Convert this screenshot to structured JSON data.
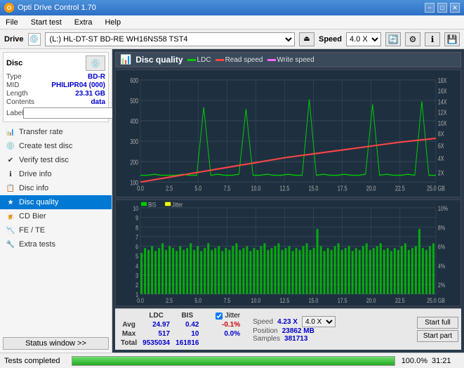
{
  "app": {
    "title": "Opti Drive Control 1.70",
    "icon": "O"
  },
  "titlebar": {
    "minimize": "−",
    "maximize": "□",
    "close": "✕"
  },
  "menu": {
    "items": [
      "File",
      "Start test",
      "Extra",
      "Help"
    ]
  },
  "drivebar": {
    "drive_label": "Drive",
    "drive_value": "(L:)  HL-DT-ST BD-RE  WH16NS58 TST4",
    "speed_label": "Speed",
    "speed_value": "4.0 X"
  },
  "disc": {
    "title": "Disc",
    "type_label": "Type",
    "type_value": "BD-R",
    "mid_label": "MID",
    "mid_value": "PHILIPR04 (000)",
    "length_label": "Length",
    "length_value": "23.31 GB",
    "contents_label": "Contents",
    "contents_value": "data",
    "label_label": "Label",
    "label_placeholder": ""
  },
  "nav": {
    "items": [
      {
        "id": "transfer-rate",
        "label": "Transfer rate",
        "icon": "📊"
      },
      {
        "id": "create-test-disc",
        "label": "Create test disc",
        "icon": "💿"
      },
      {
        "id": "verify-test-disc",
        "label": "Verify test disc",
        "icon": "✔"
      },
      {
        "id": "drive-info",
        "label": "Drive info",
        "icon": "ℹ"
      },
      {
        "id": "disc-info",
        "label": "Disc info",
        "icon": "📋"
      },
      {
        "id": "disc-quality",
        "label": "Disc quality",
        "icon": "★",
        "active": true
      },
      {
        "id": "cd-bier",
        "label": "CD Bier",
        "icon": "🍺"
      },
      {
        "id": "fe-te",
        "label": "FE / TE",
        "icon": "📉"
      },
      {
        "id": "extra-tests",
        "label": "Extra tests",
        "icon": "🔧"
      }
    ],
    "status_window": "Status window >>"
  },
  "chart": {
    "title": "Disc quality",
    "legend": [
      {
        "label": "LDC",
        "color": "#00aa00"
      },
      {
        "label": "Read speed",
        "color": "#ff0000"
      },
      {
        "label": "Write speed",
        "color": "#ff66ff"
      }
    ],
    "chart1": {
      "y_max": 600,
      "y_labels": [
        "600",
        "500",
        "400",
        "300",
        "200",
        "100"
      ],
      "y_right": [
        "18X",
        "16X",
        "14X",
        "12X",
        "10X",
        "8X",
        "6X",
        "4X",
        "2X"
      ],
      "x_labels": [
        "0.0",
        "2.5",
        "5.0",
        "7.5",
        "10.0",
        "12.5",
        "15.0",
        "17.5",
        "20.0",
        "22.5",
        "25.0 GB"
      ]
    },
    "chart2": {
      "title": "BIS",
      "title2": "Jitter",
      "y_max": 10,
      "y_labels": [
        "10",
        "9",
        "8",
        "7",
        "6",
        "5",
        "4",
        "3",
        "2",
        "1"
      ],
      "y_right": [
        "10%",
        "8%",
        "6%",
        "4%",
        "2%"
      ],
      "x_labels": [
        "0.0",
        "2.5",
        "5.0",
        "7.5",
        "10.0",
        "12.5",
        "15.0",
        "17.5",
        "20.0",
        "22.5",
        "25.0 GB"
      ]
    }
  },
  "stats": {
    "headers": [
      "LDC",
      "BIS",
      "",
      "Jitter",
      "Speed"
    ],
    "avg_label": "Avg",
    "avg_ldc": "24.97",
    "avg_bis": "0.42",
    "avg_jitter": "-0.1%",
    "max_label": "Max",
    "max_ldc": "517",
    "max_bis": "10",
    "max_jitter": "0.0%",
    "total_label": "Total",
    "total_ldc": "9535034",
    "total_bis": "161816",
    "speed_label": "Speed",
    "speed_value": "4.23 X",
    "speed_select": "4.0 X",
    "position_label": "Position",
    "position_value": "23862 MB",
    "samples_label": "Samples",
    "samples_value": "381713",
    "btn_start_full": "Start full",
    "btn_start_part": "Start part"
  },
  "statusbar": {
    "text": "Tests completed",
    "progress": 100,
    "pct": "100.0%",
    "time": "31:21"
  },
  "colors": {
    "ldc": "#00cc00",
    "bis": "#00cc00",
    "read_speed": "#ff4444",
    "write_speed": "#ff66ff",
    "jitter": "#ffff00",
    "grid": "#3a5060",
    "bg": "#1e3040"
  }
}
